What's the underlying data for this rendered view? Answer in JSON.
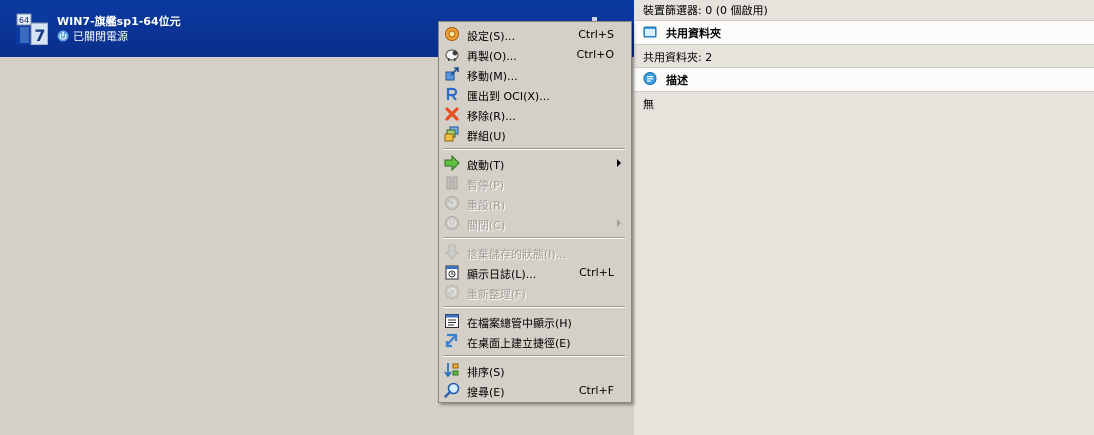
{
  "vm": {
    "name": "WIN7-旗艦sp1-64位元",
    "state": "已關閉電源",
    "os_badge": "64",
    "os_version": "7"
  },
  "details": {
    "usb_filters": "裝置篩選器:   0 (0 個啟用)",
    "shared_folders": {
      "title": "共用資料夾",
      "value": "共用資料夾:   2"
    },
    "description": {
      "title": "描述",
      "value": "無"
    }
  },
  "menu": {
    "settings": {
      "label": "設定(S)...",
      "shortcut": "Ctrl+S",
      "icon": "gear-icon"
    },
    "clone": {
      "label": "再製(O)...",
      "shortcut": "Ctrl+O",
      "icon": "sheep-icon"
    },
    "move": {
      "label": "移動(M)...",
      "icon": "move-icon"
    },
    "export_oci": {
      "label": "匯出到 OCI(X)...",
      "icon": "export-oci-icon"
    },
    "remove": {
      "label": "移除(R)...",
      "icon": "remove-icon"
    },
    "group": {
      "label": "群組(U)",
      "icon": "group-icon"
    },
    "start": {
      "label": "啟動(T)",
      "icon": "start-arrow-icon"
    },
    "pause": {
      "label": "暫停(P)",
      "icon": "pause-icon"
    },
    "reset": {
      "label": "重設(R)",
      "icon": "reset-icon"
    },
    "close": {
      "label": "關閉(C)",
      "icon": "power-off-icon"
    },
    "discard_state": {
      "label": "捨棄儲存的狀態(I)...",
      "icon": "discard-icon"
    },
    "show_log": {
      "label": "顯示日誌(L)...",
      "shortcut": "Ctrl+L",
      "icon": "log-icon"
    },
    "refresh": {
      "label": "重新整理(F)",
      "icon": "refresh-icon"
    },
    "show_in_explorer": {
      "label": "在檔案總管中顯示(H)",
      "icon": "explorer-icon"
    },
    "create_shortcut": {
      "label": "在桌面上建立捷徑(E)",
      "icon": "shortcut-icon"
    },
    "sort": {
      "label": "排序(S)",
      "icon": "sort-icon"
    },
    "search": {
      "label": "搜尋(E)",
      "shortcut": "Ctrl+F",
      "icon": "search-icon"
    }
  },
  "colors": {
    "selection_blue": "#0a2f8c",
    "menu_bg": "#d4d0c8",
    "details_bg": "#e6e2dc"
  }
}
